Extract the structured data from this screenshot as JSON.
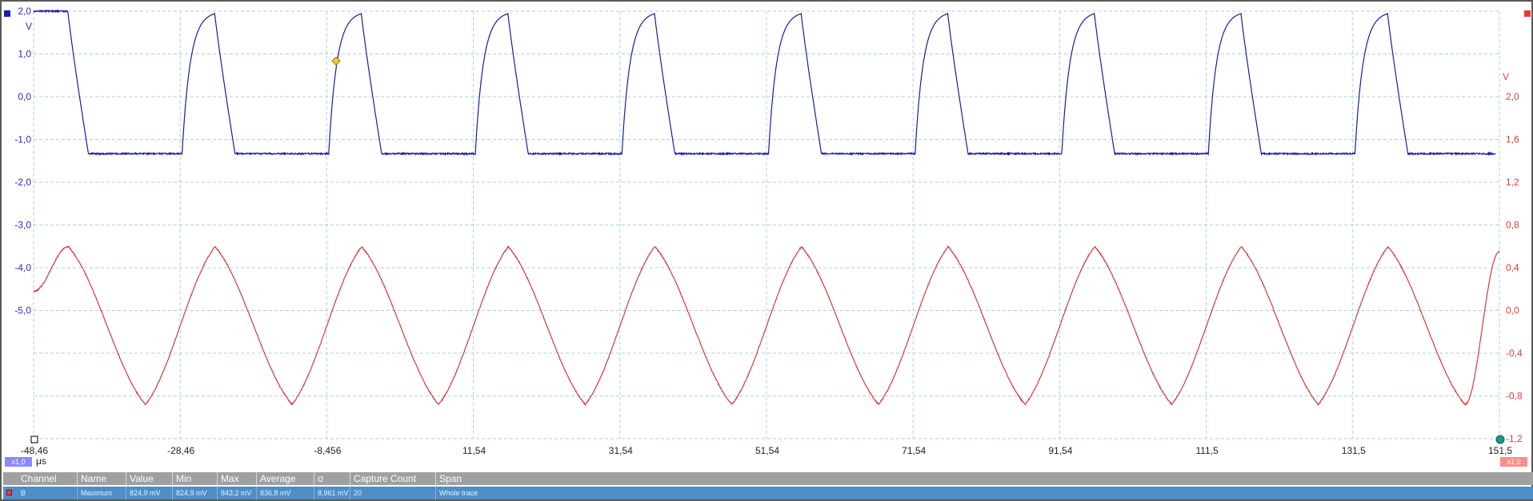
{
  "chart_data": {
    "type": "line",
    "x_unit": "μs",
    "x_ticks": [
      "-48,46",
      "-28,46",
      "-8,456",
      "11,54",
      "31,54",
      "51,54",
      "71,54",
      "91,54",
      "111,5",
      "131,5",
      "151,5"
    ],
    "xlim": [
      -48.46,
      151.5
    ],
    "left_axis": {
      "unit": "V",
      "ticks": [
        "2,0",
        "1,0",
        "0,0",
        "-1,0",
        "-2,0",
        "-3,0",
        "-4,0",
        "-5,0"
      ],
      "ylim": [
        -10.0,
        2.0
      ],
      "color": "#2b2bc0"
    },
    "right_axis": {
      "unit": "V",
      "ticks": [
        "2,0",
        "1,6",
        "1,2",
        "0,8",
        "0,4",
        "0,0",
        "-0,4",
        "-0,8",
        "-1,2"
      ],
      "ylim": [
        -1.2,
        2.6
      ],
      "color": "#e23c3c"
    },
    "grid": true,
    "series": [
      {
        "axis": "left",
        "color": "#1a1aa8",
        "shape": "square",
        "period_us": 40,
        "high_V": 2.0,
        "low_V": -2.0,
        "rise_starts_us": [
          -28.2,
          -8.2,
          11.8,
          31.8,
          51.8,
          71.8,
          91.8,
          111.8,
          131.8
        ],
        "fall_starts_us": [
          -43.8,
          -23.8,
          -3.8,
          16.2,
          36.2,
          56.2,
          76.2,
          96.2,
          116.2,
          136.2
        ],
        "end_us": 151.0
      },
      {
        "axis": "right",
        "color": "#d83a3a",
        "shape": "triangle-ish",
        "period_us": 40,
        "max_V": 0.82,
        "min_V": -0.84,
        "peaks_us": [
          -43.7,
          -23.7,
          -3.7,
          16.3,
          36.3,
          56.3,
          76.3,
          96.3,
          116.3,
          136.3
        ],
        "troughs_us": [
          -33.2,
          -13.2,
          6.8,
          26.8,
          46.8,
          66.8,
          86.8,
          106.8,
          126.8,
          146.8
        ],
        "start_V": 0.35,
        "end_V": 0.77
      }
    ],
    "trigger_marker_color": "#f0d020"
  },
  "ui": {
    "x_scale_chip": "x1,0",
    "x_unit_label": "μs",
    "right_scale_chip": "x1,0",
    "left_channel_color": "#1e1ea8",
    "right_channel_color": "#e23c3c"
  },
  "measurements": {
    "headers": [
      "Channel",
      "Name",
      "Value",
      "Min",
      "Max",
      "Average",
      "σ",
      "Capture Count",
      "Span"
    ],
    "rows": [
      {
        "channel": "B",
        "name": "Maximum",
        "value": "824,9 mV",
        "min": "824,9 mV",
        "max": "843,2 mV",
        "average": "836,8 mV",
        "sigma": "8,961 mV",
        "count": "20",
        "span": "Whole trace"
      }
    ]
  }
}
